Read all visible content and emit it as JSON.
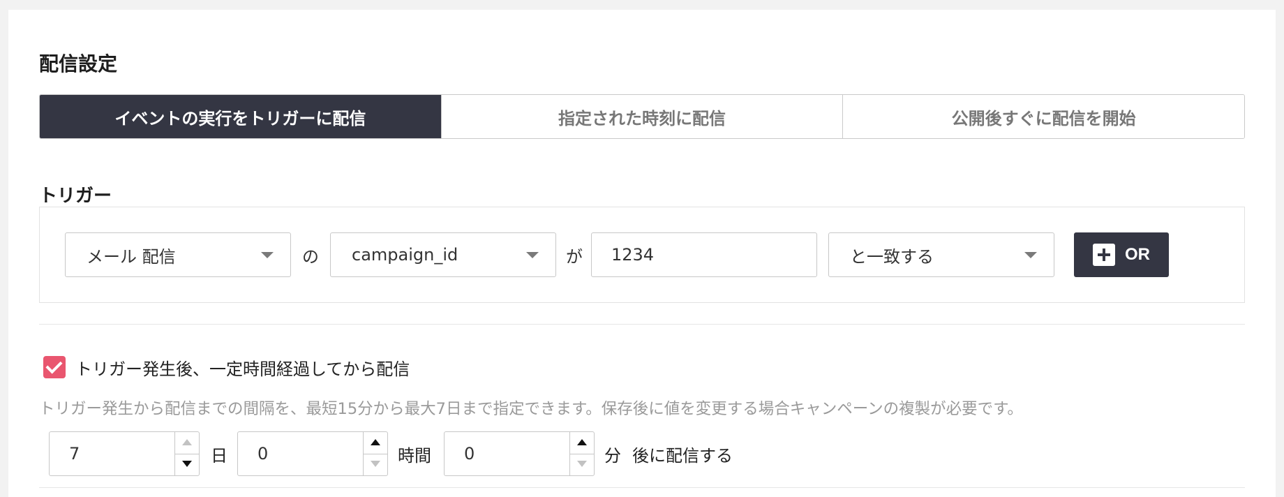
{
  "section_title": "配信設定",
  "tabs": [
    {
      "label": "イベントの実行をトリガーに配信",
      "active": true
    },
    {
      "label": "指定された時刻に配信",
      "active": false
    },
    {
      "label": "公開後すぐに配信を開始",
      "active": false
    }
  ],
  "trigger": {
    "title": "トリガー",
    "source_select": "メール 配信",
    "joiner_no": "の",
    "field_select": "campaign_id",
    "joiner_ga": "が",
    "value_input": "1234",
    "operator_select": "と一致する",
    "or_button": "OR"
  },
  "delay": {
    "checkbox_checked": true,
    "checkbox_label": "トリガー発生後、一定時間経過してから配信",
    "help_text": "トリガー発生から配信までの間隔を、最短15分から最大7日まで指定できます。保存後に値を変更する場合キャンペーンの複製が必要です。",
    "days_value": "7",
    "days_unit": "日",
    "hours_value": "0",
    "hours_unit": "時間",
    "minutes_value": "0",
    "minutes_unit": "分",
    "suffix": "後に配信する"
  },
  "colors": {
    "dark": "#343643",
    "accent_checkbox": "#e9566f"
  }
}
